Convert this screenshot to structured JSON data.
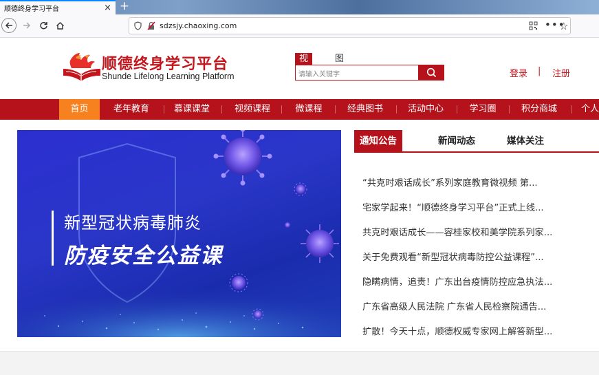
{
  "browser": {
    "tab_title": "顺德终身学习平台",
    "tab_close": "×",
    "new_tab": "+",
    "url": "sdzsjy.chaoxing.com",
    "menu_dots": "•••",
    "bookmark_star": "☆"
  },
  "header": {
    "logo_cn": "顺德终身学习平台",
    "logo_en": "Shunde Lifelong Learning Platform",
    "search_tabs": [
      "视频",
      "图书"
    ],
    "search_placeholder": "请输入关键字",
    "login": "登录",
    "separator": "|",
    "register": "注册"
  },
  "mainnav": {
    "items": [
      "首页",
      "老年教育",
      "慕课课堂",
      "视频课程",
      "微课程",
      "经典图书",
      "活动中心",
      "学习圈",
      "积分商城",
      "个人"
    ],
    "active_index": 0
  },
  "banner": {
    "line1": "新型冠状病毒肺炎",
    "line2": "防疫安全公益课"
  },
  "news": {
    "tabs": [
      "通知公告",
      "新闻动态",
      "媒体关注"
    ],
    "active_tab": 0,
    "items": [
      "“共克时艰话成长”系列家庭教育微视频 第...",
      "宅家学起来！“顺德终身学习平台”正式上线...",
      "共克时艰话成长——容桂家校和美学院系列家...",
      "关于免费观看“新型冠状病毒防控公益课程”...",
      "隐瞒病情，追责！广东出台疫情防控应急执法...",
      "广东省高级人民法院 广东省人民检察院通告...",
      "扩散！今天十点，顺德权威专家网上解答新型..."
    ]
  },
  "colors": {
    "brand_red": "#b5121b",
    "active_orange": "#f7811f",
    "banner_blue": "#2a36c8"
  }
}
